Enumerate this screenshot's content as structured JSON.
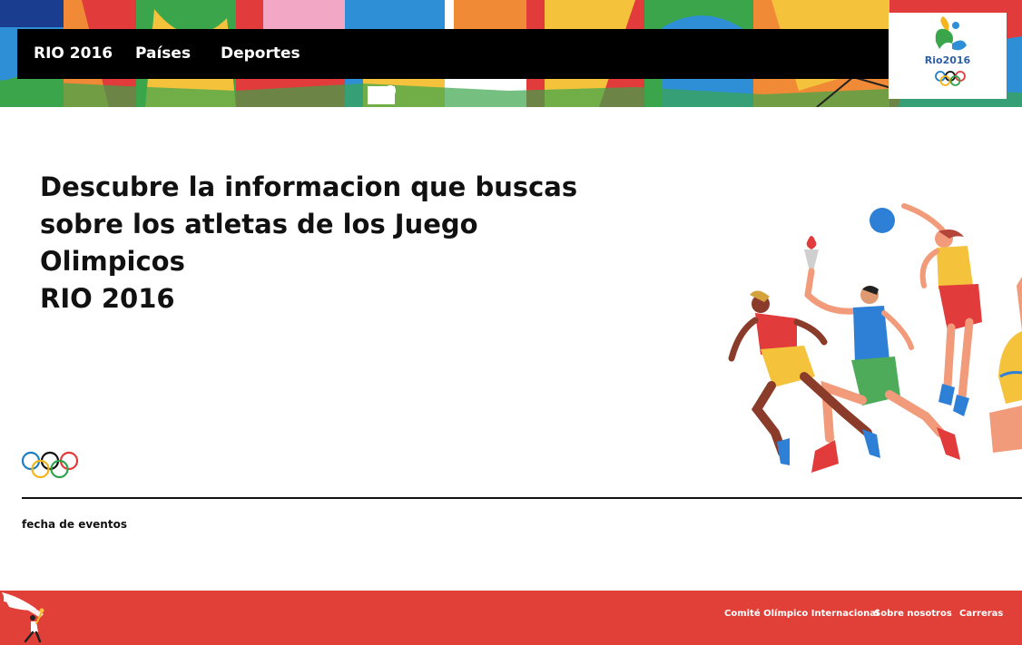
{
  "colors": {
    "nav_background": "#000000",
    "footer_background": "#e04038",
    "text_dark": "#111111",
    "text_light": "#ffffff"
  },
  "nav": {
    "brand": "RIO 2016",
    "items": [
      "Países",
      "Deportes"
    ]
  },
  "logo": {
    "text": "Rio2016"
  },
  "hero": {
    "title_lines": [
      "Descubre la informacion que buscas",
      "sobre los atletas de los Juego Olimpicos",
      "RIO 2016"
    ]
  },
  "events": {
    "label": "fecha de eventos"
  },
  "footer": {
    "links": [
      "Comité Olímpico Internacional",
      "Sobre nosotros",
      "Carreras"
    ]
  }
}
